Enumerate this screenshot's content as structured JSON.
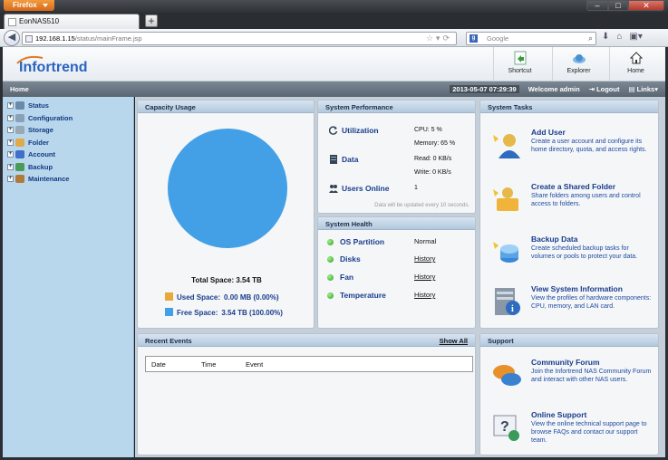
{
  "browser": {
    "app_button": "Firefox",
    "tab_title": "EonNAS510",
    "url_host": "192.168.1.15",
    "url_path": "/status/mainFrame.jsp",
    "search_placeholder": "Google",
    "search_engine_letter": "g"
  },
  "header": {
    "logo_text": "Infortrend",
    "buttons": [
      {
        "label": "Shortcut",
        "icon": "shortcut-icon"
      },
      {
        "label": "Explorer",
        "icon": "explorer-icon"
      },
      {
        "label": "Home",
        "icon": "home-icon"
      }
    ]
  },
  "strip": {
    "breadcrumb": "Home",
    "datetime": "2013-05-07 07:29:39",
    "welcome": "Welcome admin",
    "logout": "Logout",
    "links": "Links▾"
  },
  "sidebar": {
    "items": [
      {
        "label": "Status",
        "color": "#6a8aaa"
      },
      {
        "label": "Configuration",
        "color": "#8aa0b8"
      },
      {
        "label": "Storage",
        "color": "#9aa8b6"
      },
      {
        "label": "Folder",
        "color": "#e0a94a"
      },
      {
        "label": "Account",
        "color": "#3f6fc6"
      },
      {
        "label": "Backup",
        "color": "#4a9a5a"
      },
      {
        "label": "Maintenance",
        "color": "#b07a3a"
      }
    ]
  },
  "capacity": {
    "title": "Capacity Usage",
    "total": "Total Space: 3.54 TB",
    "used_label": "Used Space:",
    "used_value": "0.00 MB (0.00%)",
    "free_label": "Free Space:",
    "free_value": "3.54 TB (100.00%)",
    "used_color": "#e8a83a",
    "free_color": "#43a0e6",
    "used_fraction": 0.0,
    "free_fraction": 1.0
  },
  "performance": {
    "title": "System Performance",
    "utilization_label": "Utilization",
    "cpu": "CPU: 5 %",
    "memory": "Memory: 65 %",
    "data_label": "Data",
    "read": "Read: 0 KB/s",
    "write": "Write: 0 KB/s",
    "users_label": "Users Online",
    "users_value": "1",
    "note": "Data will be updated every 10 seconds."
  },
  "health": {
    "title": "System Health",
    "rows": [
      {
        "label": "OS Partition",
        "value": "Normal",
        "link": false
      },
      {
        "label": "Disks",
        "value": "History",
        "link": true
      },
      {
        "label": "Fan",
        "value": "History",
        "link": true
      },
      {
        "label": "Temperature",
        "value": "History",
        "link": true
      }
    ]
  },
  "tasks": {
    "title": "System Tasks",
    "items": [
      {
        "title": "Add User",
        "desc": "Create a user account and configure its home directory, quota, and access rights."
      },
      {
        "title": "Create a Shared Folder",
        "desc": "Share folders among users and control access to folders."
      },
      {
        "title": "Backup Data",
        "desc": "Create scheduled backup tasks for volumes or pools to protect your data."
      },
      {
        "title": "View System Information",
        "desc": "View the profiles of hardware components: CPU, memory, and LAN card."
      }
    ]
  },
  "events": {
    "title": "Recent Events",
    "show_all": "Show All",
    "columns": [
      "Date",
      "Time",
      "Event"
    ]
  },
  "support": {
    "title": "Support",
    "items": [
      {
        "title": "Community Forum",
        "desc": "Join the Infortrend NAS Community Forum and interact with other NAS users."
      },
      {
        "title": "Online Support",
        "desc": "View the online technical support page to browse FAQs and contact our support team."
      }
    ]
  }
}
